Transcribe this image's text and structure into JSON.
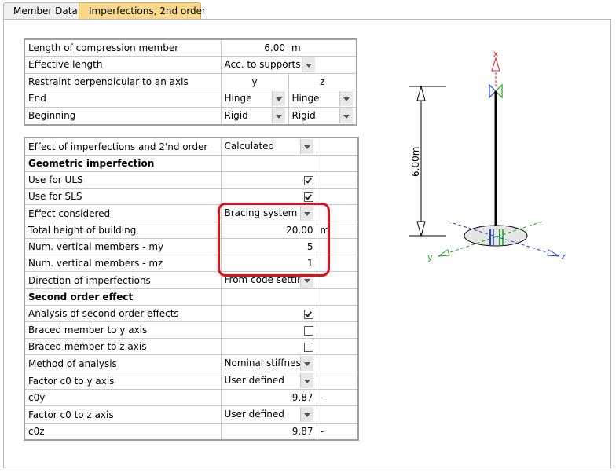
{
  "tabs": [
    "Member Data",
    "Imperfections, 2nd order"
  ],
  "top_table": {
    "length_label": "Length of compression member",
    "length_value": "6.00",
    "length_unit": "m",
    "eff_length_label": "Effective length",
    "eff_length_value": "Acc. to supports",
    "restraint_label": "Restraint perpendicular to an axis",
    "axis_y": "y",
    "axis_z": "z",
    "end_label": "End",
    "end_y": "Hinge",
    "end_z": "Hinge",
    "beginning_label": "Beginning",
    "begin_y": "Rigid",
    "begin_z": "Rigid"
  },
  "main_table": {
    "effect_label": "Effect of imperfections and 2'nd order",
    "effect_value": "Calculated",
    "geo_header": "Geometric imperfection",
    "uls_label": "Use for ULS",
    "sls_label": "Use for SLS",
    "effect_considered_label": "Effect considered",
    "effect_considered_value": "Bracing system",
    "height_label": "Total height of building",
    "height_value": "20.00",
    "height_unit": "m",
    "my_label": "Num. vertical members  - my",
    "my_value": "5",
    "mz_label": "Num. vertical members  - mz",
    "mz_value": "1",
    "direction_label": "Direction of imperfections",
    "direction_value": "From code setting",
    "second_header": "Second order effect",
    "analysis_label": "Analysis of second order effects",
    "braced_y_label": "Braced member to y axis",
    "braced_z_label": "Braced member to z axis",
    "method_label": "Method of analysis",
    "method_value": "Nominal stiffness",
    "factor_y_label": "Factor c0 to y axis",
    "factor_y_value": "User defined",
    "c0y_label": "c0y",
    "c0y_value": "9.87",
    "c0y_unit": "-",
    "factor_z_label": "Factor c0 to z axis",
    "factor_z_value": "User defined",
    "c0z_label": "c0z",
    "c0z_value": "9.87",
    "c0z_unit": "-"
  },
  "checkboxes": {
    "uls": true,
    "sls": true,
    "analysis": true,
    "braced_y": false,
    "braced_z": false
  },
  "diagram": {
    "dimension_label": "6.00m",
    "x_label": "x",
    "y_label": "y",
    "z_label": "z"
  },
  "colors": {
    "active_tab": "#fbd78a",
    "highlight": "#e0101a",
    "x_axis": "#e02020",
    "y_axis": "#20a020",
    "z_axis": "#2040d0"
  }
}
